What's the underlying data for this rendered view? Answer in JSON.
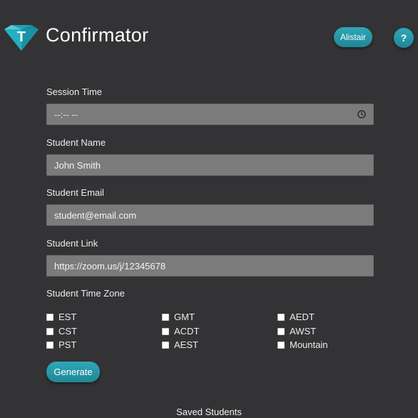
{
  "app": {
    "title": "Confirmator",
    "logo_letter": "T",
    "user_button": "Alistair",
    "help_button": "?",
    "accent_color": "#26a1b3"
  },
  "form": {
    "session_time": {
      "label": "Session Time",
      "placeholder": "--:-- --",
      "icon": "clock-icon"
    },
    "student_name": {
      "label": "Student Name",
      "value": "John Smith"
    },
    "student_email": {
      "label": "Student Email",
      "value": "student@email.com"
    },
    "student_link": {
      "label": "Student Link",
      "value": "https://zoom.us/j/12345678"
    },
    "time_zone": {
      "label": "Student Time Zone",
      "options": [
        {
          "label": "EST",
          "checked": false
        },
        {
          "label": "CST",
          "checked": false
        },
        {
          "label": "PST",
          "checked": false
        },
        {
          "label": "GMT",
          "checked": false
        },
        {
          "label": "ACDT",
          "checked": false
        },
        {
          "label": "AEST",
          "checked": false
        },
        {
          "label": "AEDT",
          "checked": false
        },
        {
          "label": "AWST",
          "checked": false
        },
        {
          "label": "Mountain",
          "checked": false
        }
      ]
    },
    "generate_button": "Generate"
  },
  "saved": {
    "title": "Saved Students"
  }
}
